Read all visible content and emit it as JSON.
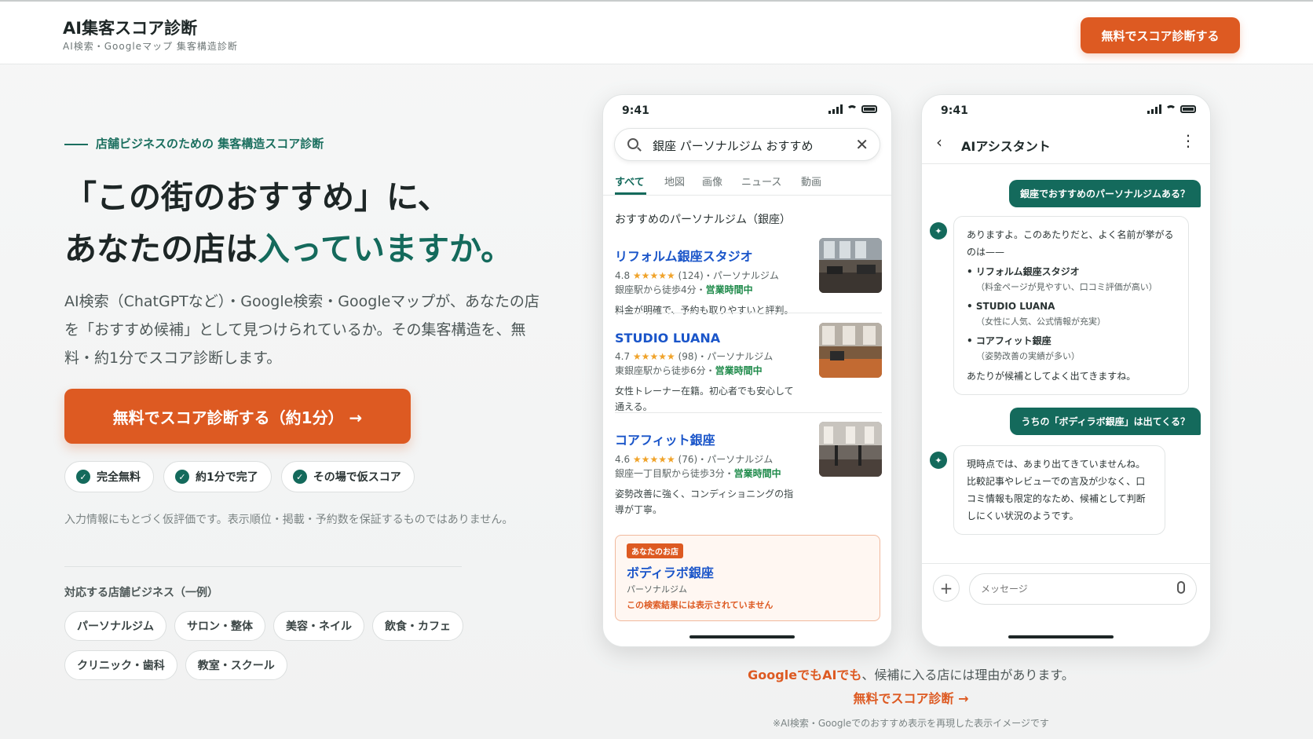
{
  "header": {
    "title": "AI集客スコア診断",
    "subtitle": "AI検索・Googleマップ 集客構造診断",
    "cta": "無料でスコア診断する"
  },
  "hero": {
    "eyebrow": "店舗ビジネスのための 集客構造スコア診断",
    "headline_line1": "「この街のおすすめ」に、",
    "headline_line2_prefix": "あなたの店は",
    "headline_line2_accent": "入っていますか。",
    "lead": "AI検索（ChatGPTなど）・Google検索・Googleマップが、あなたの店を「おすすめ候補」として見つけられているか。その集客構造を、無料・約1分でスコア診断します。",
    "cta": "無料でスコア診断する（約1分）  →",
    "chips": [
      "完全無料",
      "約1分で完了",
      "その場で仮スコア"
    ],
    "disclaimer": "入力情報にもとづく仮評価です。表示順位・掲載・予約数を保証するものではありません。",
    "biz_title": "対応する店舗ビジネス（一例）",
    "biz_tags": [
      "パーソナルジム",
      "サロン・整体",
      "美容・ネイル",
      "飲食・カフェ",
      "クリニック・歯科",
      "教室・スクール"
    ]
  },
  "phone_search": {
    "time": "9:41",
    "query": "銀座 パーソナルジム おすすめ",
    "tabs": [
      "すべて",
      "地図",
      "画像",
      "ニュース",
      "動画"
    ],
    "results_title": "おすすめのパーソナルジム（銀座）",
    "results": [
      {
        "name": "リフォルム銀座スタジオ",
        "rating": "4.8",
        "stars": "★★★★★",
        "reviews": "(124)",
        "category": "・パーソナルジム",
        "access": "銀座駅から徒歩4分・",
        "hours": "営業時間中",
        "desc": "料金が明確で、予約も取りやすいと評判。"
      },
      {
        "name": "STUDIO LUANA",
        "rating": "4.7",
        "stars": "★★★★★",
        "reviews": "(98)",
        "category": "・パーソナルジム",
        "access": "東銀座駅から徒歩6分・",
        "hours": "営業時間中",
        "desc": "女性トレーナー在籍。初心者でも安心して通える。"
      },
      {
        "name": "コアフィット銀座",
        "rating": "4.6",
        "stars": "★★★★★",
        "reviews": "(76)",
        "category": "・パーソナルジム",
        "access": "銀座一丁目駅から徒歩3分・",
        "hours": "営業時間中",
        "desc": "姿勢改善に強く、コンディショニングの指導が丁寧。"
      }
    ],
    "your_shop": {
      "badge": "あなたのお店",
      "name": "ボディラボ銀座",
      "category": "パーソナルジム",
      "warning": "この検索結果には表示されていません"
    }
  },
  "phone_chat": {
    "time": "9:41",
    "title": "AIアシスタント",
    "user_msg1": "銀座でおすすめのパーソナルジムある？",
    "ai_msg1_intro": "ありますよ。このあたりだと、よく名前が挙がるのは——",
    "ai_msg1_items": [
      {
        "name": "リフォルム銀座スタジオ",
        "note": "（料金ページが見やすい、口コミ評価が高い）"
      },
      {
        "name": "STUDIO LUANA",
        "note": "（女性に人気、公式情報が充実）"
      },
      {
        "name": "コアフィット銀座",
        "note": "（姿勢改善の実績が多い）"
      }
    ],
    "ai_msg1_outro": "あたりが候補としてよく出てきますね。",
    "user_msg2": "うちの「ボディラボ銀座」は出てくる？",
    "ai_msg2": "現時点では、あまり出てきていませんね。比較記事やレビューでの言及が少なく、口コミ情報も限定的なため、候補として判断しにくい状況のようです。",
    "input_placeholder": "メッセージ"
  },
  "captions": {
    "line1_em": "GoogleでもAIでも",
    "line1_rest": "、候補に入る店には理由があります。",
    "link": "無料でスコア診断 →",
    "note": "※AI検索・Googleでのおすすめ表示を再現した表示イメージです"
  }
}
